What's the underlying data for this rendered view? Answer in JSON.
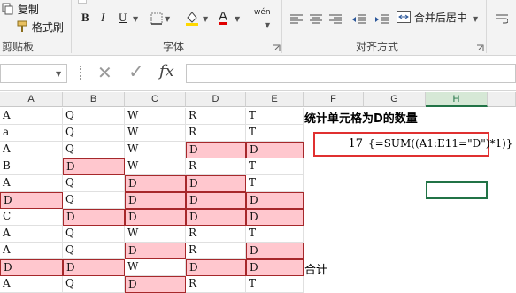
{
  "ribbon": {
    "clipboard": {
      "copy_label": "复制",
      "format_painter_label": "格式刷",
      "group_label": "剪贴板"
    },
    "font": {
      "bold": "B",
      "italic": "I",
      "underline": "U",
      "color_letter": "A",
      "wen_label": "wén",
      "group_label": "字体"
    },
    "alignment": {
      "merge_label": "合并后居中",
      "group_label": "对齐方式"
    }
  },
  "formula_bar": {
    "fx_label": "fx",
    "cancel_glyph": "✕",
    "confirm_glyph": "✓"
  },
  "columns": [
    "A",
    "B",
    "C",
    "D",
    "E",
    "F",
    "G",
    "H"
  ],
  "selected_column": "H",
  "rows": [
    [
      "A",
      "Q",
      "W",
      "R",
      "T"
    ],
    [
      "a",
      "Q",
      "W",
      "R",
      "T"
    ],
    [
      "A",
      "Q",
      "W",
      "D",
      "D"
    ],
    [
      "B",
      "D",
      "W",
      "R",
      "T"
    ],
    [
      "A",
      "Q",
      "D",
      "D",
      "T"
    ],
    [
      "D",
      "Q",
      "D",
      "D",
      "D"
    ],
    [
      "C",
      "D",
      "D",
      "D",
      "D"
    ],
    [
      "A",
      "Q",
      "W",
      "R",
      "T"
    ],
    [
      "A",
      "Q",
      "D",
      "R",
      "D"
    ],
    [
      "D",
      "D",
      "W",
      "D",
      "D"
    ],
    [
      "A",
      "Q",
      "D",
      "R",
      "T"
    ]
  ],
  "highlighted": [
    [
      2,
      3
    ],
    [
      2,
      4
    ],
    [
      3,
      1
    ],
    [
      4,
      2
    ],
    [
      4,
      3
    ],
    [
      5,
      0
    ],
    [
      5,
      2
    ],
    [
      5,
      3
    ],
    [
      5,
      4
    ],
    [
      6,
      1
    ],
    [
      6,
      2
    ],
    [
      6,
      3
    ],
    [
      6,
      4
    ],
    [
      8,
      2
    ],
    [
      8,
      4
    ],
    [
      9,
      0
    ],
    [
      9,
      1
    ],
    [
      9,
      3
    ],
    [
      9,
      4
    ],
    [
      10,
      2
    ]
  ],
  "title": "统计单元格为D的数量",
  "result": {
    "value": "17",
    "formula": "{=SUM((A1:E11=\"D\")*1)}"
  },
  "total_label": "合计",
  "colors": {
    "highlight_fill": "#ffc7ce",
    "highlight_border": "#a6282b",
    "result_border": "#e03030",
    "excel_green": "#217346"
  }
}
